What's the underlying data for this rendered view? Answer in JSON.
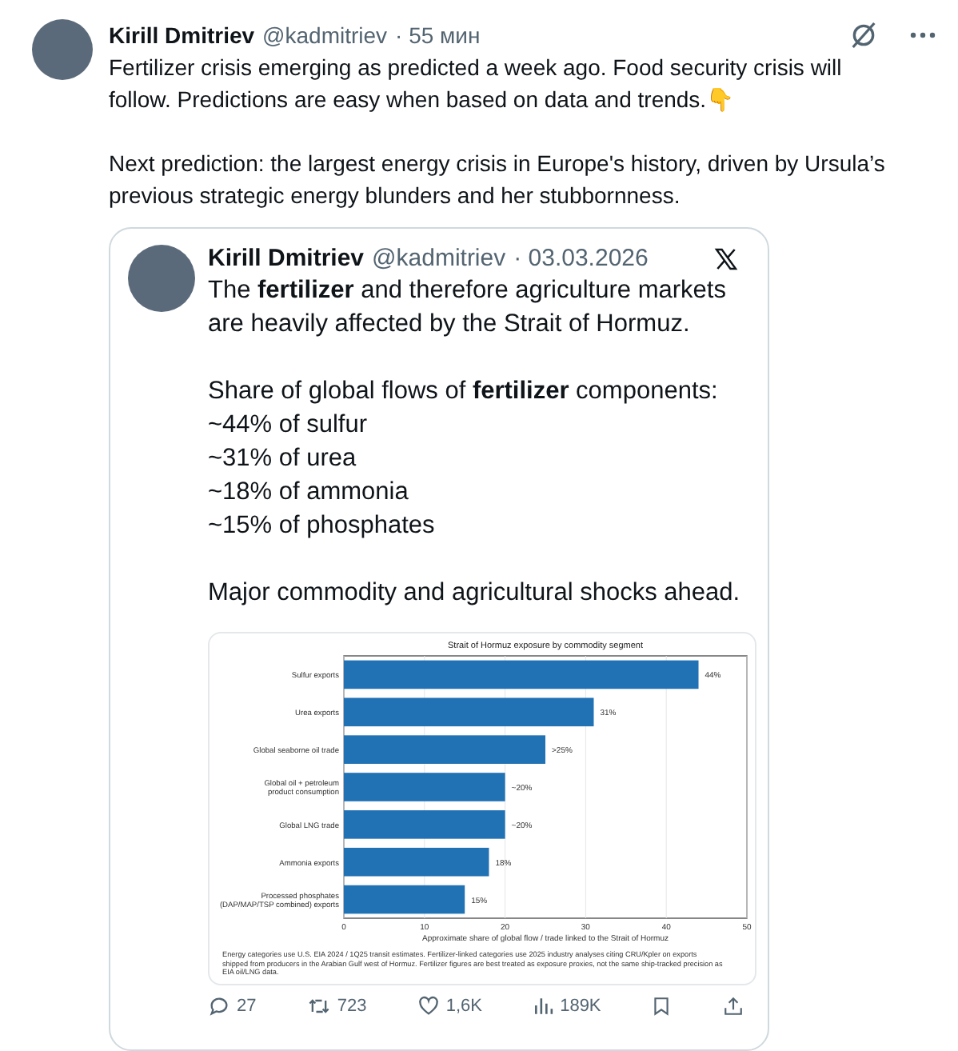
{
  "post": {
    "author": "Kirill Dmitriev",
    "handle": "@kadmitriev",
    "time": "· 55 мин",
    "paragraphs": [
      "Fertilizer crisis emerging as predicted a week ago. Food security crisis will follow. Predictions are easy when based on data and trends.👇",
      "Next prediction: the largest energy crisis in Europe's history, driven by Ursula’s previous strategic energy blunders and her stubbornness."
    ]
  },
  "quote": {
    "author": "Kirill Dmitriev",
    "handle": "@kadmitriev",
    "date": "· 03.03.2026",
    "paragraphs": [
      [
        "The **fertilizer** and therefore agriculture markets are heavily affected by the Strait of Hormuz."
      ],
      [
        "Share of global flows of **fertilizer** components:",
        "~44% of sulfur",
        "~31% of urea",
        "~18% of ammonia",
        "~15% of phosphates"
      ],
      [
        "Major commodity and agricultural shocks ahead."
      ]
    ],
    "chart_data": {
      "type": "bar",
      "orientation": "horizontal",
      "title": "Strait of Hormuz exposure by commodity segment",
      "xlabel": "Approximate share of global flow / trade linked to the Strait of Hormuz",
      "categories": [
        "Sulfur exports",
        "Urea exports",
        "Global seaborne oil trade",
        "Global oil + petroleum\nproduct consumption",
        "Global LNG trade",
        "Ammonia exports",
        "Processed phosphates\n(DAP/MAP/TSP combined) exports"
      ],
      "values": [
        44,
        31,
        25,
        20,
        20,
        18,
        15
      ],
      "value_labels": [
        "44%",
        "31%",
        ">25%",
        "~20%",
        "~20%",
        "18%",
        "15%"
      ],
      "xlim": [
        0,
        50
      ],
      "grid": true,
      "xticks": [
        0,
        10,
        20,
        30,
        40,
        50
      ]
    },
    "chart_note": "Energy categories use U.S. EIA 2024 / 1Q25 transit estimates. Fertilizer-linked categories use 2025 industry analyses citing CRU/Kpler on exports shipped from producers in the Arabian Gulf west of Hormuz. Fertilizer figures are best treated as exposure proxies, not the same ship-tracked precision as EIA oil/LNG data."
  },
  "actions": [
    {
      "kind": "reply",
      "count": "27"
    },
    {
      "kind": "repost",
      "count": "723"
    },
    {
      "kind": "like",
      "count": "1,6K"
    },
    {
      "kind": "views",
      "count": "189K"
    },
    {
      "kind": "bookmark"
    },
    {
      "kind": "share"
    }
  ]
}
